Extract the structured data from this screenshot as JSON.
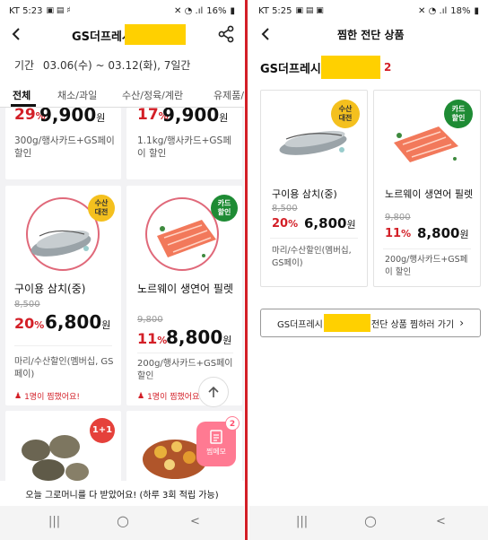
{
  "left": {
    "status": {
      "time": "KT 5:23",
      "battery": "16%"
    },
    "store_title": "GS더프레시",
    "period_label": "기간",
    "period_value": "03.06(수) ~ 03.12(화), 7일간",
    "tabs": [
      {
        "label": "전체",
        "active": true
      },
      {
        "label": "채소/과일"
      },
      {
        "label": "수산/정육/계란"
      },
      {
        "label": "유제품/"
      }
    ],
    "top_cards": [
      {
        "percent": "29",
        "price": "9,900",
        "unit": "원",
        "desc": "300g/행사카드+GS페이 할인"
      },
      {
        "percent": "17",
        "price": "9,900",
        "unit": "원",
        "desc": "1.1kg/행사카드+GS페이 할인"
      }
    ],
    "products": [
      {
        "name": "구이용 삼치(중)",
        "old_price": "8,500",
        "percent": "20",
        "price": "6,800",
        "unit": "원",
        "desc": "마리/수산할인(멤버십, GS페이)",
        "zzim": "1명이 찜했어요!",
        "badge": "수산\n대전"
      },
      {
        "name": "노르웨이 생연어 필렛",
        "old_price": "9,800",
        "percent": "11",
        "price": "8,800",
        "unit": "원",
        "desc": "200g/행사카드+GS페이 할인",
        "zzim": "1명이 찜했어요",
        "badge": "카드\n할인"
      }
    ],
    "bottom_badges": {
      "one_plus_one": "1+1",
      "memo_label": "찜메모",
      "memo_count": "2"
    },
    "toast": "오늘 그로머니를 다 받았어요! (하루 3회 적립 가능)"
  },
  "right": {
    "status": {
      "time": "KT 5:25",
      "battery": "18%"
    },
    "page_title": "찜한 전단 상품",
    "store_title": "GS더프레시",
    "count": "2",
    "products": [
      {
        "name": "구이용 삼치(중)",
        "old_price": "8,500",
        "percent": "20",
        "price": "6,800",
        "unit": "원",
        "desc": "마리/수산할인(멤버십, GS페이)",
        "badge": "수산\n대전"
      },
      {
        "name": "노르웨이 생연어 필렛",
        "old_price": "9,800",
        "percent": "11",
        "price": "8,800",
        "unit": "원",
        "desc": "200g/행사카드+GS페이 할인",
        "badge": "카드\n할인"
      }
    ],
    "goto_prefix": "GS더프레시",
    "goto_suffix": "전단 상품 찜하러 가기"
  },
  "navbar": {
    "recent": "|||",
    "home": "○",
    "back": "<"
  }
}
